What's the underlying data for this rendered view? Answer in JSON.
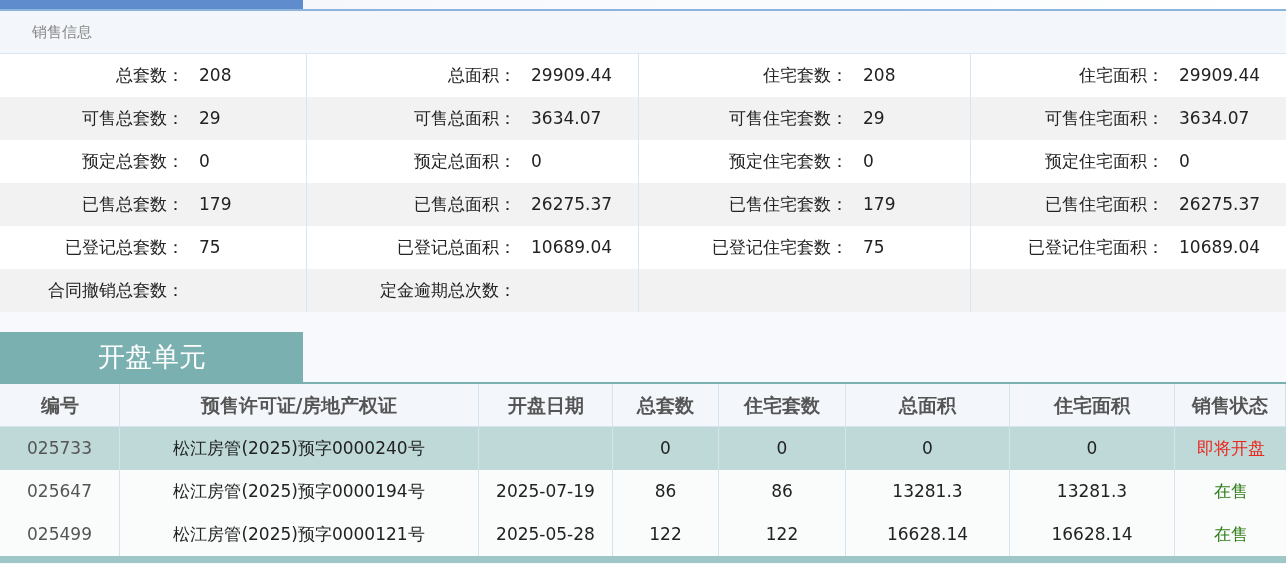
{
  "sales_info": {
    "title": "销售信息",
    "rows": [
      [
        {
          "label": "总套数：",
          "value": "208"
        },
        {
          "label": "总面积：",
          "value": "29909.44"
        },
        {
          "label": "住宅套数：",
          "value": "208"
        },
        {
          "label": "住宅面积：",
          "value": "29909.44"
        }
      ],
      [
        {
          "label": "可售总套数：",
          "value": "29"
        },
        {
          "label": "可售总面积：",
          "value": "3634.07"
        },
        {
          "label": "可售住宅套数：",
          "value": "29"
        },
        {
          "label": "可售住宅面积：",
          "value": "3634.07"
        }
      ],
      [
        {
          "label": "预定总套数：",
          "value": "0"
        },
        {
          "label": "预定总面积：",
          "value": "0"
        },
        {
          "label": "预定住宅套数：",
          "value": "0"
        },
        {
          "label": "预定住宅面积：",
          "value": "0"
        }
      ],
      [
        {
          "label": "已售总套数：",
          "value": "179"
        },
        {
          "label": "已售总面积：",
          "value": "26275.37"
        },
        {
          "label": "已售住宅套数：",
          "value": "179"
        },
        {
          "label": "已售住宅面积：",
          "value": "26275.37"
        }
      ],
      [
        {
          "label": "已登记总套数：",
          "value": "75"
        },
        {
          "label": "已登记总面积：",
          "value": "10689.04"
        },
        {
          "label": "已登记住宅套数：",
          "value": "75"
        },
        {
          "label": "已登记住宅面积：",
          "value": "10689.04"
        }
      ],
      [
        {
          "label": "合同撤销总套数："
        },
        {
          "label": "定金逾期总次数："
        },
        {},
        {}
      ]
    ]
  },
  "units": {
    "title": "开盘单元",
    "columns": [
      "编号",
      "预售许可证/房地产权证",
      "开盘日期",
      "总套数",
      "住宅套数",
      "总面积",
      "住宅面积",
      "销售状态"
    ],
    "rows": [
      {
        "selected": true,
        "cells": [
          "025733",
          "松江房管(2025)预字0000240号",
          "",
          "0",
          "0",
          "0",
          "0"
        ],
        "status": {
          "text": "即将开盘",
          "color": "#e8281e"
        }
      },
      {
        "selected": false,
        "cells": [
          "025647",
          "松江房管(2025)预字0000194号",
          "2025-07-19",
          "86",
          "86",
          "13281.3",
          "13281.3"
        ],
        "status": {
          "text": "在售",
          "color": "#2e7d1a"
        }
      },
      {
        "selected": false,
        "cells": [
          "025499",
          "松江房管(2025)预字0000121号",
          "2025-05-28",
          "122",
          "122",
          "16628.14",
          "16628.14"
        ],
        "status": {
          "text": "在售",
          "color": "#2e7d1a"
        }
      }
    ]
  }
}
